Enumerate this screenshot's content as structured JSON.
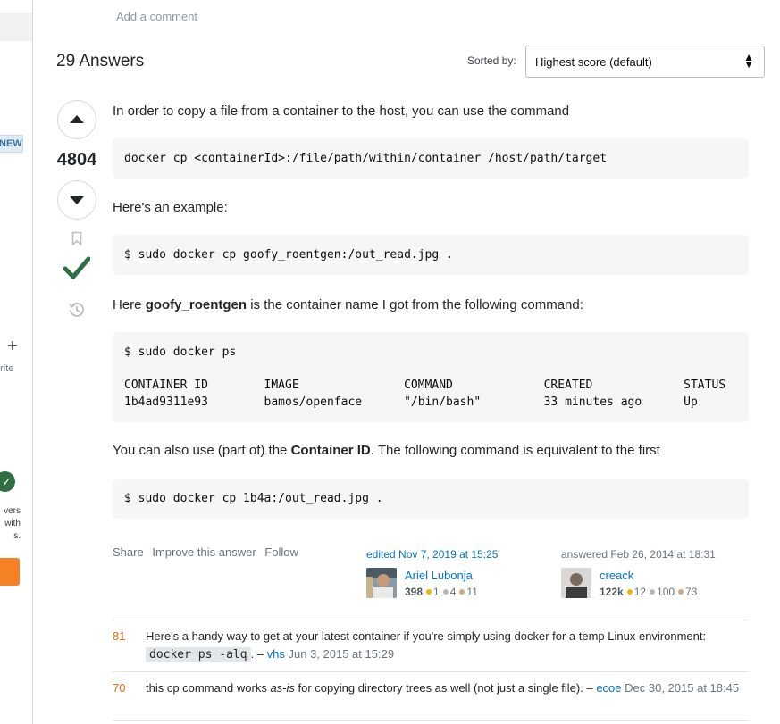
{
  "sidebar": {
    "new_badge": "NEW",
    "plus": "+",
    "favorite_label": "orite",
    "team_text": [
      "vers",
      "with",
      "s."
    ]
  },
  "add_comment": "Add a comment",
  "answers": {
    "count_label": "29 Answers",
    "sort_label": "Sorted by:",
    "sort_value": "Highest score (default)"
  },
  "answer": {
    "score": "4804",
    "p1": "In order to copy a file from a container to the host, you can use the command",
    "code1": "docker cp <containerId>:/file/path/within/container /host/path/target",
    "p2": "Here's an example:",
    "code2": "$ sudo docker cp goofy_roentgen:/out_read.jpg .",
    "p3_pre": "Here ",
    "p3_bold": "goofy_roentgen",
    "p3_post": " is the container name I got from the following command:",
    "code3": "$ sudo docker ps\n\nCONTAINER ID        IMAGE               COMMAND             CREATED             STATUS\n1b4ad9311e93        bamos/openface      \"/bin/bash\"         33 minutes ago      Up",
    "p4_pre": "You can also use (part of) the ",
    "p4_bold": "Container ID",
    "p4_post": ". The following command is equivalent to the first",
    "code4": "$ sudo docker cp 1b4a:/out_read.jpg .",
    "menu": {
      "share": "Share",
      "improve": "Improve this answer",
      "follow": "Follow"
    },
    "editor": {
      "action": "edited Nov 7, 2019 at 15:25",
      "name": "Ariel Lubonja",
      "rep": "398",
      "gold": "1",
      "silver": "4",
      "bronze": "11"
    },
    "author": {
      "action": "answered Feb 26, 2014 at 18:31",
      "name": "creack",
      "rep": "122k",
      "gold": "12",
      "silver": "100",
      "bronze": "73"
    }
  },
  "comments": [
    {
      "score": "81",
      "text_pre": "Here's a handy way to get at your latest container if you're simply using docker for a temp Linux environment: ",
      "code": "docker ps -alq",
      "text_post": ". – ",
      "user": "vhs",
      "date": " Jun 3, 2015 at 15:29"
    },
    {
      "score": "70",
      "text_pre": "this cp command works ",
      "italic": "as-is",
      "text_post": " for copying directory trees as well (not just a single file). – ",
      "user": "ecoe",
      "date": " Dec 30, 2015 at 18:45"
    }
  ],
  "colors": {
    "link": "#0074cc",
    "accepted": "#2f6f44",
    "comment_score": "#e46d1a",
    "orange": "#f48225"
  }
}
